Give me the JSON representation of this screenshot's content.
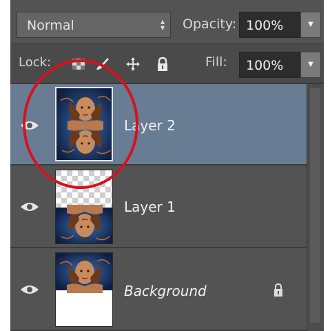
{
  "blend_mode": {
    "selected": "Normal"
  },
  "opacity": {
    "label": "Opacity:",
    "value": "100%"
  },
  "lock": {
    "label": "Lock:"
  },
  "fill": {
    "label": "Fill:",
    "value": "100%"
  },
  "layers": [
    {
      "name": "Layer 2",
      "selected": true,
      "visible": true,
      "locked": false
    },
    {
      "name": "Layer 1",
      "selected": false,
      "visible": true,
      "locked": false
    },
    {
      "name": "Background",
      "selected": false,
      "visible": true,
      "locked": true
    }
  ],
  "colors": {
    "panel": "#535353",
    "selected_row": "#687c94",
    "annotation_circle": "#d4131f"
  },
  "icons": [
    "eye-icon",
    "lock-transparent-icon",
    "lock-brush-icon",
    "lock-move-icon",
    "lock-all-icon",
    "chevron-down-icon"
  ]
}
